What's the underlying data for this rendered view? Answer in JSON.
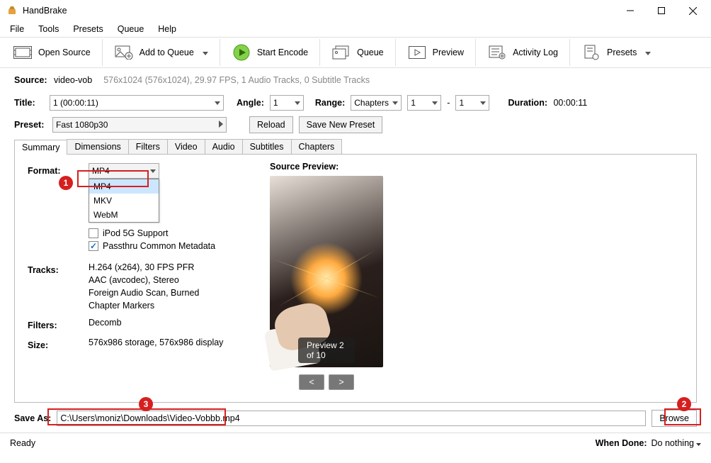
{
  "window": {
    "title": "HandBrake"
  },
  "menu": {
    "file": "File",
    "tools": "Tools",
    "presets": "Presets",
    "queue": "Queue",
    "help": "Help"
  },
  "toolbar": {
    "open": "Open Source",
    "add": "Add to Queue",
    "start": "Start Encode",
    "queue": "Queue",
    "preview": "Preview",
    "activity": "Activity Log",
    "presets": "Presets"
  },
  "source": {
    "label": "Source:",
    "name": "video-vob",
    "info": "576x1024 (576x1024), 29.97 FPS, 1 Audio Tracks, 0 Subtitle Tracks"
  },
  "titleRow": {
    "label": "Title:",
    "value": "1  (00:00:11)",
    "angle": "Angle:",
    "angleVal": "1",
    "range": "Range:",
    "rangeMode": "Chapters",
    "from": "1",
    "dash": "-",
    "to": "1",
    "dur": "Duration:",
    "durVal": "00:00:11"
  },
  "presetRow": {
    "label": "Preset:",
    "value": "Fast 1080p30",
    "reload": "Reload",
    "savenew": "Save New Preset"
  },
  "tabs": {
    "summary": "Summary",
    "dimensions": "Dimensions",
    "filters": "Filters",
    "video": "Video",
    "audio": "Audio",
    "subtitles": "Subtitles",
    "chapters": "Chapters"
  },
  "summary": {
    "format": "Format:",
    "formatVal": "MP4",
    "formatOpts": {
      "mp4": "MP4",
      "mkv": "MKV",
      "webm": "WebM"
    },
    "ipod": "iPod 5G Support",
    "passthru": "Passthru Common Metadata",
    "tracks": "Tracks:",
    "t1": "H.264 (x264), 30 FPS PFR",
    "t2": "AAC (avcodec), Stereo",
    "t3": "Foreign Audio Scan, Burned",
    "t4": "Chapter Markers",
    "filters": "Filters:",
    "filtersVal": "Decomb",
    "size": "Size:",
    "sizeVal": "576x986 storage, 576x986 display",
    "previewLabel": "Source Preview:",
    "previewBadge": "Preview 2 of 10",
    "prev": "<",
    "next": ">"
  },
  "saveAs": {
    "label": "Save As:",
    "path": "C:\\Users\\moniz\\Downloads\\Video-Vobbb.mp4",
    "browse": "Browse"
  },
  "status": {
    "ready": "Ready",
    "whenDone": "When Done:",
    "action": "Do nothing"
  },
  "callouts": {
    "c1": "1",
    "c2": "2",
    "c3": "3"
  }
}
